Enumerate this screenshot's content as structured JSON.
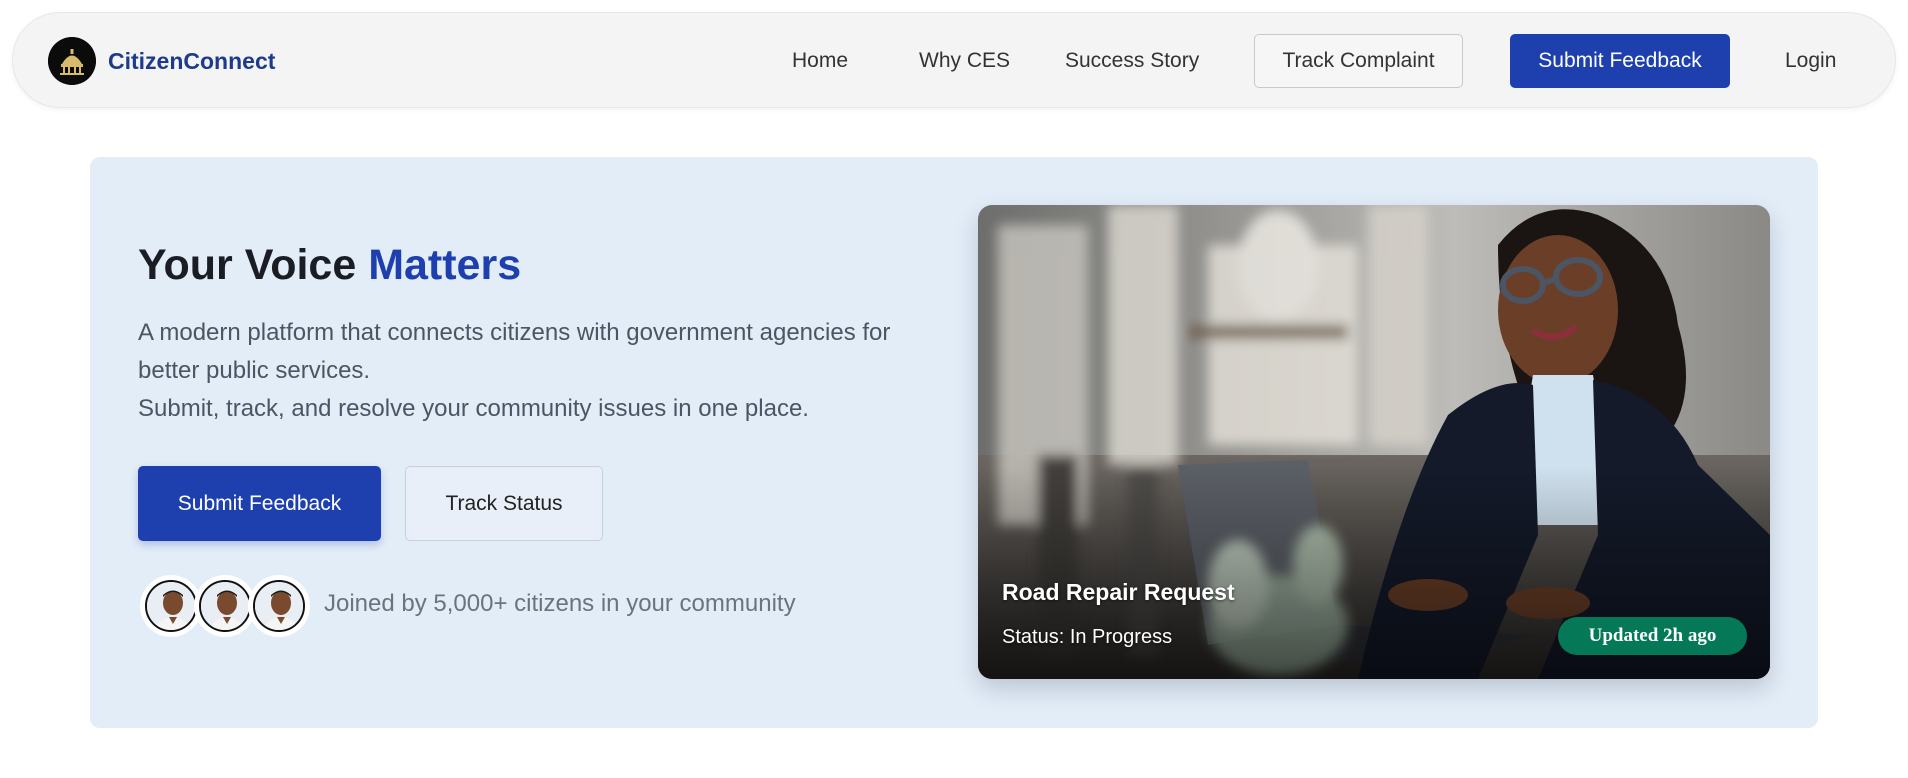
{
  "nav": {
    "brand": "CitizenConnect",
    "home": "Home",
    "why": "Why CES",
    "success": "Success Story",
    "track": "Track Complaint",
    "submit": "Submit Feedback",
    "login": "Login"
  },
  "hero": {
    "title_prefix": "Your Voice ",
    "title_accent": "Matters",
    "desc_line1": "A modern platform that connects citizens with government agencies for better public services.",
    "desc_line2": "Submit, track, and resolve your community issues in one place.",
    "primary_button": "Submit Feedback",
    "secondary_button": "Track Status",
    "community_text": "Joined by 5,000+ citizens in your community"
  },
  "card": {
    "title": "Road Repair Request",
    "status": "Status: In Progress",
    "badge": "Updated 2h ago"
  },
  "colors": {
    "brand": "#1e3a8a",
    "primary": "#1e40af",
    "hero_bg": "#e3edf8",
    "badge": "#047857"
  },
  "icons": {
    "logo": "dome-building-logo",
    "avatar": "person-avatar"
  }
}
